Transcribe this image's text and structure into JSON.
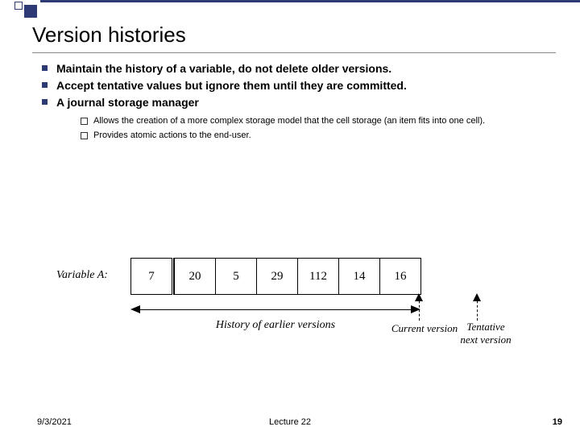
{
  "title": "Version histories",
  "bullets": {
    "b1": "Maintain the history of a variable, do not delete older versions.",
    "b2": "Accept tentative values but  ignore them until they are committed.",
    "b3": "A journal storage manager"
  },
  "sub": {
    "s1": "Allows the creation of a more complex  storage model that the cell storage (an item fits into one cell).",
    "s2": "Provides atomic actions  to the end-user."
  },
  "diagram": {
    "var_label": "Variable A:",
    "cells": {
      "c0": "7",
      "c1": "20",
      "c2": "5",
      "c3": "29",
      "c4": "112",
      "c5": "14",
      "c6": "16"
    },
    "history_label": "History of earlier versions",
    "current_label": "Current version",
    "tentative_label": "Tentative\nnext version"
  },
  "footer": {
    "date": "9/3/2021",
    "lecture": "Lecture 22",
    "page": "19"
  }
}
